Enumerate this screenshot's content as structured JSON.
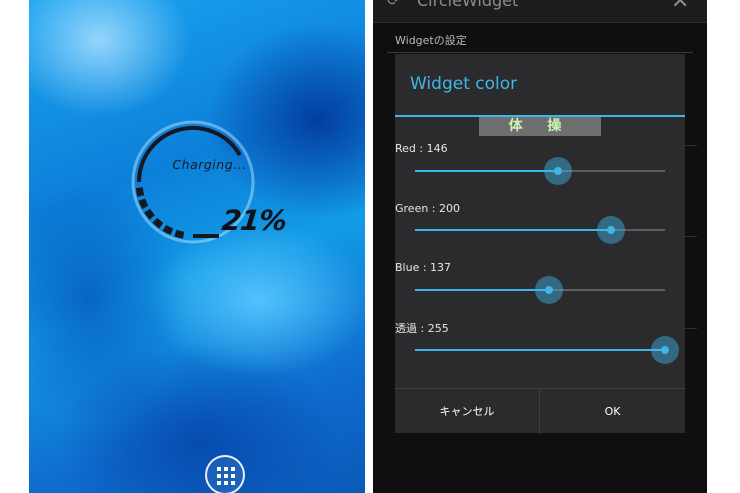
{
  "left_phone": {
    "widget": {
      "status_text": "Charging...",
      "percent_text": "21%",
      "level": 0.21
    },
    "apps_icon": "apps-grid-icon"
  },
  "right_phone": {
    "app_bar": {
      "title": "CircleWidget",
      "icon": "circle-widget-icon",
      "close_icon": "close-icon"
    },
    "settings_header": "Widgetの設定",
    "dialog": {
      "title": "Widget color",
      "watermark": "体 操",
      "sliders": [
        {
          "label": "Red : 146",
          "value": 146,
          "max": 255
        },
        {
          "label": "Green : 200",
          "value": 200,
          "max": 255
        },
        {
          "label": "Blue : 137",
          "value": 137,
          "max": 255
        },
        {
          "label": "透過 : 255",
          "value": 255,
          "max": 255
        }
      ],
      "cancel_label": "キャンセル",
      "ok_label": "OK"
    }
  },
  "colors": {
    "accent": "#3fb6e8",
    "dialog_bg": "#2b2b2d",
    "screen_bg": "#0f0f10",
    "widget_ring_dark": "#141820",
    "wallpaper_blue": "#1289e0"
  }
}
